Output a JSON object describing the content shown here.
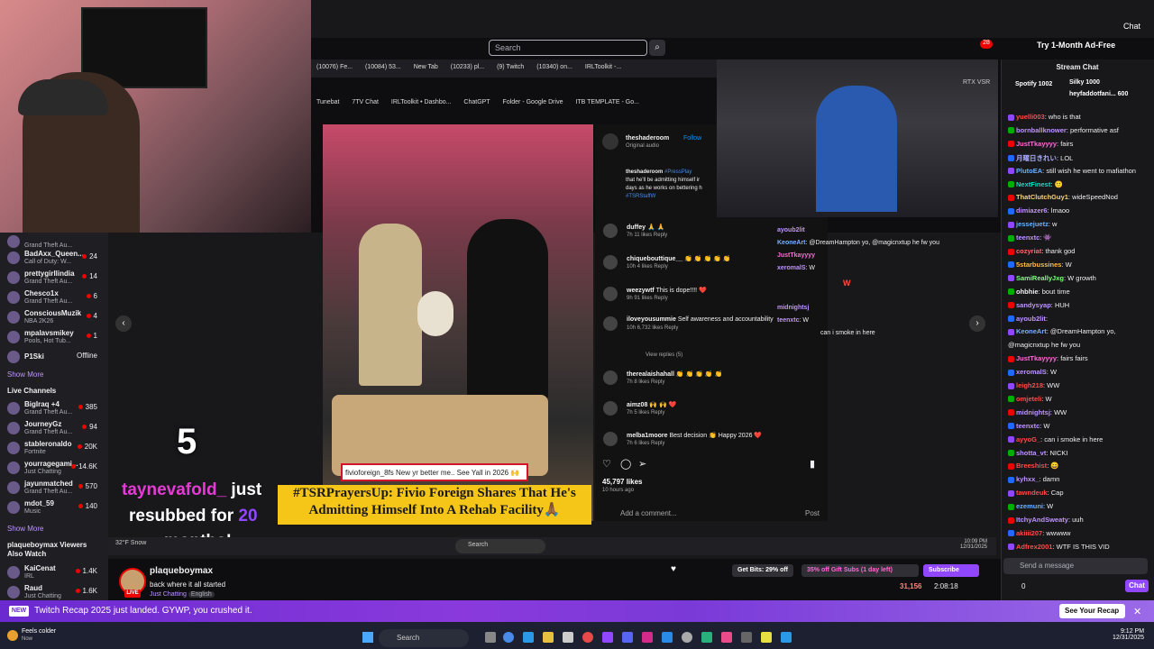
{
  "browser": {
    "search_placeholder": "Search",
    "ad_free": "Try 1-Month Ad-Free",
    "chat_label": "Chat",
    "notif_count": "28"
  },
  "inner_browser": {
    "tabs": [
      "(10076) Fe...",
      "(10084) 53...",
      "New Tab",
      "(10233) pl...",
      "(9) Twitch",
      "(10340) on...",
      "IRLToolkit -..."
    ],
    "bookmarks": [
      "Tunebat",
      "7TV Chat",
      "IRLToolkit • Dashbo...",
      "ChatGPT",
      "Folder - Google Drive",
      "ITB TEMPLATE - Go..."
    ]
  },
  "sidebar": {
    "followed": [
      {
        "name": "",
        "game": "Grand Theft Au...",
        "viewers": ""
      },
      {
        "name": "BadAxx_Queen...",
        "game": "Call of Duty: W...",
        "viewers": "24"
      },
      {
        "name": "prettygirllindia",
        "game": "Grand Theft Au...",
        "viewers": "14"
      },
      {
        "name": "Chesco1x",
        "game": "Grand Theft Au...",
        "viewers": "6"
      },
      {
        "name": "ConsciousMuzik",
        "game": "NBA 2K26",
        "viewers": "4"
      },
      {
        "name": "mpalavsmikey",
        "game": "Pools, Hot Tub...",
        "viewers": "1"
      },
      {
        "name": "P1Ski",
        "game": "",
        "viewers": "Offline"
      }
    ],
    "show_more": "Show More",
    "live_channels_title": "Live Channels",
    "live_channels": [
      {
        "name": "BigIraq +4",
        "game": "Grand Theft Au...",
        "viewers": "385"
      },
      {
        "name": "JourneyGz",
        "game": "Grand Theft Au...",
        "viewers": "94"
      },
      {
        "name": "stableronaldo",
        "game": "Fortnite",
        "viewers": "20K"
      },
      {
        "name": "yourragegami...",
        "game": "Just Chatting",
        "viewers": "14.6K"
      },
      {
        "name": "jayunmatched",
        "game": "Grand Theft Au...",
        "viewers": "570"
      },
      {
        "name": "mdot_59",
        "game": "Music",
        "viewers": "140"
      }
    ],
    "show_more2": "Show More",
    "also_watch_title": "plaqueboymax Viewers Also Watch",
    "also_watch": [
      {
        "name": "KaiCenat",
        "game": "IRL",
        "viewers": "1.4K"
      },
      {
        "name": "Raud",
        "game": "Just Chatting",
        "viewers": "1.6K"
      }
    ]
  },
  "instagram": {
    "account": "theshaderoom",
    "follow": "Follow",
    "audio": "Original audio",
    "caption_user": "theshaderoom",
    "caption_tag": "#PressPlay",
    "caption_l1": "that he'll be admitting himself ir",
    "caption_l2": "days as he works on bettering h",
    "caption_tag2": "#TSRStaffW",
    "comments": [
      {
        "user": "duffey",
        "text": "🙏 🙏",
        "meta": "7h   11 likes   Reply"
      },
      {
        "user": "chiquebouttique__",
        "text": "👏 👏 👏 👏 👏",
        "meta": "10h   4 likes   Reply"
      },
      {
        "user": "weezywtf",
        "text": "This is dope!!!! ❤️",
        "meta": "9h   91 likes   Reply"
      },
      {
        "user": "iloveyousummie",
        "text": "Self awareness and accountability",
        "meta": "10h   6,732 likes   Reply"
      },
      {
        "user": "therealaishahall",
        "text": "👏 👏 👏 👏 👏",
        "meta": "7h   8 likes   Reply"
      },
      {
        "user": "aimz08",
        "text": "🙌 🙌 ❤️",
        "meta": "7h   5 likes   Reply"
      },
      {
        "user": "melba1moore",
        "text": "Best decision 👏 Happy 2026 ❤️",
        "meta": "7h   6 likes   Reply"
      }
    ],
    "view_replies": "View replies (5)",
    "likes": "45,797 likes",
    "ago": "10 hours ago",
    "add_comment": "Add a comment...",
    "post": "Post"
  },
  "overlay": {
    "caption_box": "fivioforeign_8fs New yr better me.. See Yall in 2026 🙌",
    "headline_l1": "#TSRPrayersUp: Fivio Foreign Shares That He's",
    "headline_l2": "Admitting Himself Into A Rehab Facility🙏🏾",
    "alert_number": "5",
    "alert_user": "taynevafold_",
    "alert_just": " just",
    "alert_resub": "resubbed for ",
    "alert_months_num": "20",
    "alert_months": "months!",
    "pip_badge": "RTX VSR"
  },
  "stream_chat_overlay": [
    {
      "user": "ayoub2lit",
      "text": ""
    },
    {
      "user": "KeoneArt",
      "text": "@DreamHampton yo, @magicnxtup he fw you"
    },
    {
      "user": "JustTkayyyy",
      "text": ""
    },
    {
      "user": "xeromalS",
      "text": "W"
    },
    {
      "user": "",
      "text": "W"
    },
    {
      "user": "midnightsj",
      "text": ""
    },
    {
      "user": "teenxtc",
      "text": "W"
    },
    {
      "user": "",
      "text": "can i smoke in here"
    }
  ],
  "inner_taskbar": {
    "weather": "32°F Snow",
    "search": "Search",
    "time": "10:09 PM",
    "date": "12/31/2025"
  },
  "chat": {
    "title": "Stream Chat",
    "pinned_1": "Spotify  1002",
    "pinned_2": "Silky  1000",
    "pinned_3": "heyfaddotfani...  600",
    "messages": [
      {
        "user": "yuelli003",
        "text": ": who is that",
        "color": "#ff4a4a"
      },
      {
        "user": "bornballknower",
        "text": ": performative asf",
        "color": "#bf94ff"
      },
      {
        "user": "JustTkayyyy",
        "text": ": fairs",
        "color": "#ff6ad5"
      },
      {
        "user": "月曜日きれい",
        "text": ": LOL",
        "color": "#aaaaff"
      },
      {
        "user": "PlutoEA",
        "text": ": still wish he went to mafiathon",
        "color": "#6ab0ff"
      },
      {
        "user": "NextFinest",
        "text": ": 🙂",
        "color": "#00e6cb"
      },
      {
        "user": "ThatClutchGuy1",
        "text": ": wideSpeedNod",
        "color": "#ffd37a"
      },
      {
        "user": "dimiazer6",
        "text": ": lmaoo",
        "color": "#bf94ff"
      },
      {
        "user": "jessejuetz",
        "text": ": w",
        "color": "#6ab0ff"
      },
      {
        "user": "teenxtc",
        "text": ": 👾",
        "color": "#bf94ff"
      },
      {
        "user": "cozyriat",
        "text": ": thank god",
        "color": "#ff6a6a"
      },
      {
        "user": "5starbussines",
        "text": ": W",
        "color": "#ffbd4a"
      },
      {
        "user": "SamiReallyJxg",
        "text": ": W growth",
        "color": "#7aff7a"
      },
      {
        "user": "ohbhie",
        "text": ": bout time",
        "color": "#efeff1"
      },
      {
        "user": "sandysyap",
        "text": ": HUH",
        "color": "#bf94ff"
      },
      {
        "user": "ayoub2lit",
        "text": ": ",
        "color": "#bf94ff"
      },
      {
        "user": "KeoneArt",
        "text": ": @DreamHampton yo,",
        "color": "#7ab0ff"
      },
      {
        "user": "",
        "text": "@magicnxtup he fw you",
        "color": "#efeff1"
      },
      {
        "user": "JustTkayyyy",
        "text": ": fairs fairs",
        "color": "#ff6ad5"
      },
      {
        "user": "xeromalS",
        "text": ": W",
        "color": "#bf94ff"
      },
      {
        "user": "leigh218",
        "text": ": WW",
        "color": "#ff4a4a"
      },
      {
        "user": "omjeteli",
        "text": ": W",
        "color": "#ff4a4a"
      },
      {
        "user": "midnightsj",
        "text": ": WW",
        "color": "#bf94ff"
      },
      {
        "user": "teenxtc",
        "text": ": W",
        "color": "#bf94ff"
      },
      {
        "user": "ayyoG_",
        "text": ": can i smoke in here",
        "color": "#ff4a4a"
      },
      {
        "user": "shotta_vt",
        "text": ": NICKI",
        "color": "#bf94ff"
      },
      {
        "user": "Breeshist",
        "text": ": 😄",
        "color": "#ff4a4a"
      },
      {
        "user": "kyhxx_",
        "text": ": damn",
        "color": "#bf94ff"
      },
      {
        "user": "tawndeuk",
        "text": ": Cap",
        "color": "#ff4a4a"
      },
      {
        "user": "ezemuni",
        "text": ": W",
        "color": "#6ab0ff"
      },
      {
        "user": "ItchyAndSweaty",
        "text": ": uuh",
        "color": "#bf94ff"
      },
      {
        "user": "akiiii207",
        "text": ": wwwww",
        "color": "#ff4a4a"
      },
      {
        "user": "Adfrex2001",
        "text": ": WTF IS THIS VID",
        "color": "#ff4a4a"
      }
    ],
    "send_placeholder": "Send a message",
    "points": "0",
    "chat_btn": "Chat"
  },
  "stream_info": {
    "streamer": "plaqueboymax",
    "title": "back where it all started",
    "category": "Just Chatting",
    "language": "English",
    "live": "LIVE",
    "bits": "Get Bits: 29% off",
    "gift": "35% off Gift Subs (1 day left)",
    "subscribe": "Subscribe",
    "viewers": "31,156",
    "uptime": "2:08:18"
  },
  "recap": {
    "badge": "NEW",
    "text": "Twitch Recap 2025 just landed. GYWP, you crushed it.",
    "button": "See Your Recap"
  },
  "taskbar": {
    "weather_title": "Feels colder",
    "weather_sub": "Now",
    "search": "Search",
    "time": "9:12 PM",
    "date": "12/31/2025"
  }
}
